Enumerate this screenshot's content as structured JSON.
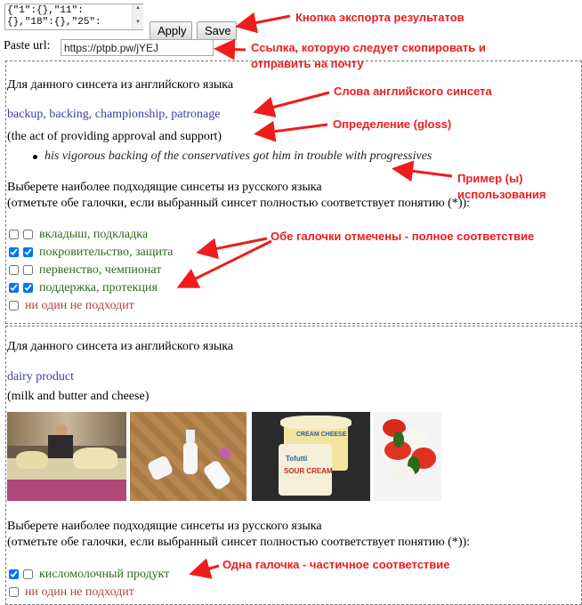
{
  "toolbar": {
    "code_value": "{\"1\":{},\"11\":\n{},\"18\":{},\"25\":",
    "apply_label": "Apply",
    "save_label": "Save",
    "paste_label": "Paste url:",
    "url_value": "https://ptpb.pw/jYEJ"
  },
  "synset1": {
    "intro": "Для данного синсета из английского языка",
    "words": "backup, backing, championship, patronage",
    "gloss": "(the act of providing approval and support)",
    "example": "his vigorous backing of the conservatives got him in trouble with progressives",
    "choose_line1": "Выберете наиболее подходящие синсеты из русского языка",
    "choose_line2": "(отметьте обе галочки, если выбранный синсет полностью соответствует понятию (*)):",
    "options": [
      {
        "label": "вкладыш, подкладка",
        "check1": false,
        "check2": false
      },
      {
        "label": "покровительство, защита",
        "check1": true,
        "check2": true
      },
      {
        "label": "первенство, чемпионат",
        "check1": false,
        "check2": false
      },
      {
        "label": "поддержка, протекция",
        "check1": true,
        "check2": true
      }
    ],
    "none_label": "ни один не подходит"
  },
  "synset2": {
    "intro": "Для данного синсета из английского языка",
    "words": "dairy product",
    "gloss": "(milk and butter and cheese)",
    "choose_line1": "Выберете наиболее подходящие синсеты из русского языка",
    "choose_line2": "(отметьте обе галочки, если выбранный синсет полностью соответствует понятию (*)):",
    "options": [
      {
        "label": "кисломолочный продукт",
        "check1": true,
        "check2": false
      }
    ],
    "none_label": "ни один не подходит",
    "photo_texts": {
      "sour_cream_lid": "SOUR CREAM",
      "cream_cheese": "CREAM CHEESE",
      "brand": "Tofutti"
    }
  },
  "annotations": {
    "export_button": "Кнопка экспорта результатов",
    "copy_link_line1": "Ссылка, которую следует скопировать и",
    "copy_link_line2": "отправить на почту",
    "english_words": "Слова английского синсета",
    "definition": "Определение (gloss)",
    "example_line1": "Пример (ы)",
    "example_line2": "использования",
    "both_checks": "Обе галочки отмечены - полное соответствие",
    "one_check": "Одна галочка - частичное соответствие"
  },
  "colors": {
    "annotation": "#ee1c1c",
    "synset_words": "#3c3ca0",
    "option_green": "#2e6b1e",
    "none_option": "#b04040"
  }
}
